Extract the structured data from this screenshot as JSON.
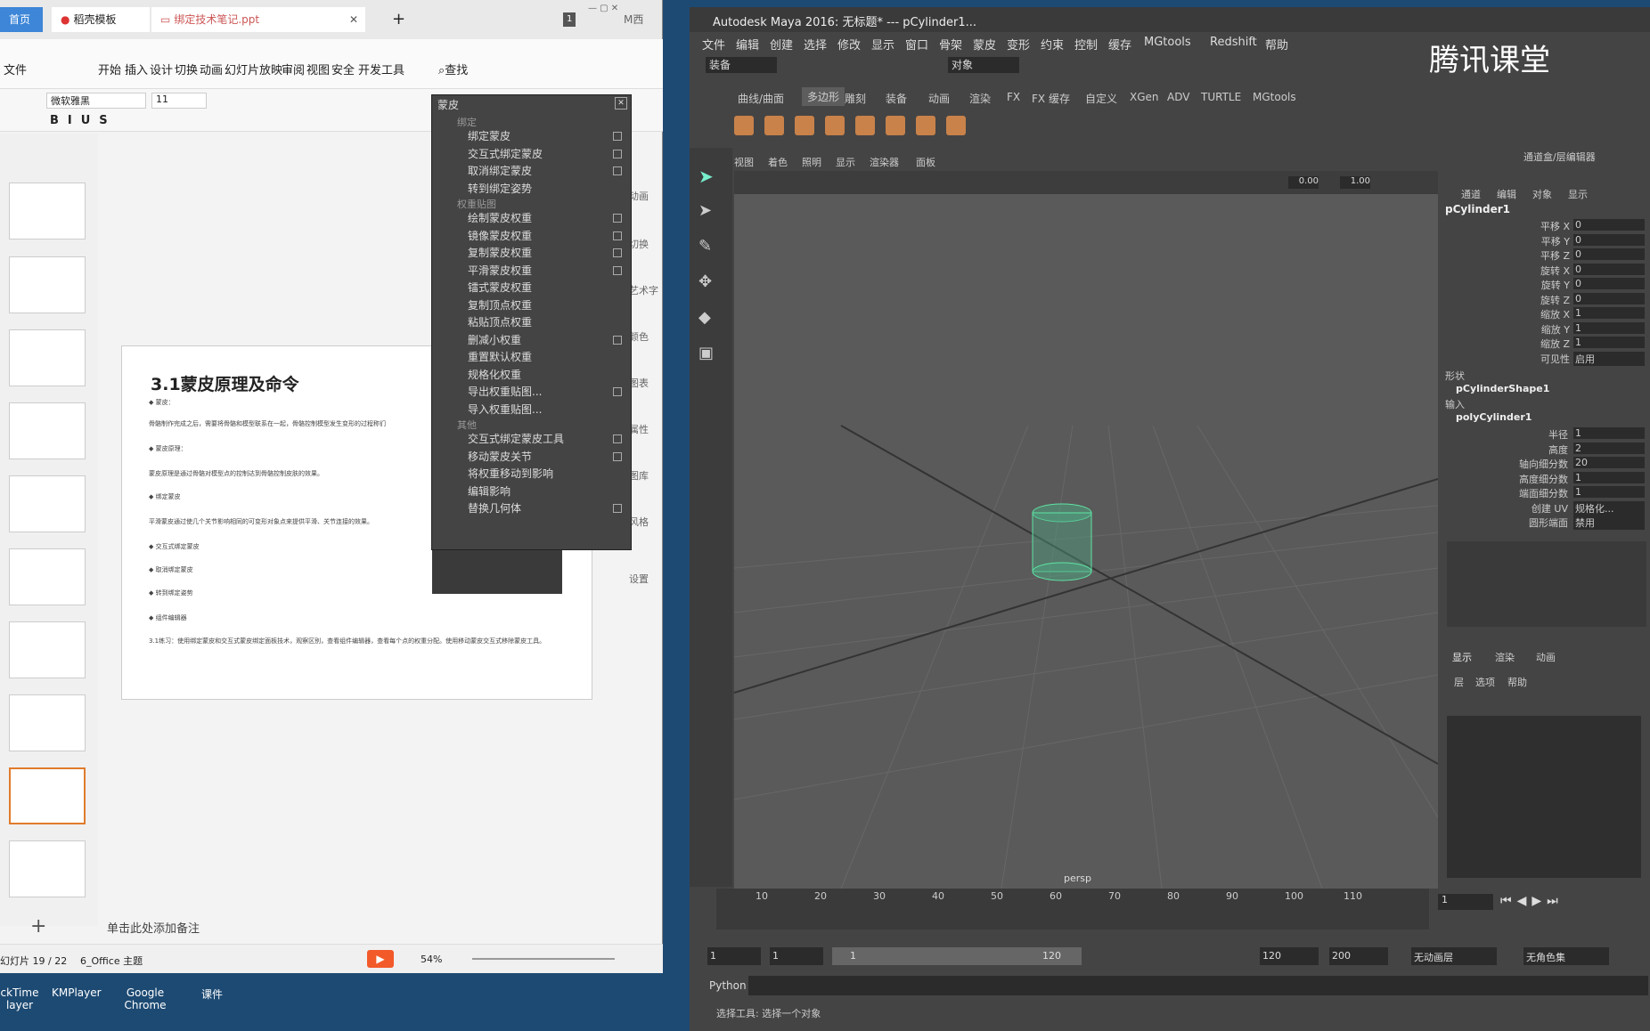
{
  "wps": {
    "tab_home": "首页",
    "tab_template": "稻壳模板",
    "tab_file": "绑定技术笔记.ppt",
    "tab_count": "1",
    "user": "M西",
    "menus": [
      "文件",
      "开始",
      "插入",
      "设计",
      "切换",
      "动画",
      "幻灯片放映",
      "审阅",
      "视图",
      "安全",
      "开发工具"
    ],
    "search": "查找",
    "font": "微软雅黑",
    "size": "11",
    "slide_title": "3.1蒙皮原理及命令",
    "slide_lines": [
      "◆ 蒙皮：",
      "骨骼制作完成之后，需要将骨骼和模型联系在一起，骨骼控制模型发生变形的过程称们",
      "◆ 蒙皮原理：",
      "蒙皮原理是通过骨骼对模型点的控制达到骨骼控制皮肤的效果。",
      "◆ 绑定蒙皮",
      "平滑蒙皮通过使几个关节影响相同的可变形对象点来提供平滑、关节连接的效果。",
      "◆ 交互式绑定蒙皮",
      "◆ 取消绑定蒙皮",
      "◆ 转到绑定姿势",
      "◆ 组件编辑器",
      "3.1练习：使用绑定蒙皮和交互式蒙皮绑定面板技术，观察区别，查看组件编辑器，查看每个点的权重分配。使用移动蒙皮交互式移除蒙皮工具。"
    ],
    "right_tools": [
      "动画",
      "切换",
      "艺术字",
      "颜色",
      "图表",
      "属性",
      "图库",
      "风格",
      "设置"
    ],
    "notes": "单击此处添加备注",
    "status_slide": "幻灯片 19 / 22",
    "theme": "6_Office 主题",
    "zoom": "54%",
    "taskbar": [
      "ckTime layer",
      "KMPlayer",
      "Google Chrome",
      "课件"
    ]
  },
  "menu": {
    "title": "蒙皮",
    "sections": [
      {
        "header": "绑定",
        "items": [
          {
            "label": "绑定蒙皮",
            "box": true
          },
          {
            "label": "交互式绑定蒙皮",
            "box": true
          },
          {
            "label": "取消绑定蒙皮",
            "box": true
          },
          {
            "label": "转到绑定姿势",
            "box": false
          }
        ]
      },
      {
        "header": "权重贴图",
        "items": [
          {
            "label": "绘制蒙皮权重",
            "box": true
          },
          {
            "label": "镜像蒙皮权重",
            "box": true
          },
          {
            "label": "复制蒙皮权重",
            "box": true
          },
          {
            "label": "平滑蒙皮权重",
            "box": true
          },
          {
            "label": "镭式蒙皮权重",
            "box": false
          },
          {
            "label": "复制顶点权重",
            "box": false
          },
          {
            "label": "粘贴顶点权重",
            "box": false
          },
          {
            "label": "删减小权重",
            "box": true
          },
          {
            "label": "重置默认权重",
            "box": false
          },
          {
            "label": "规格化权重",
            "box": false
          },
          {
            "label": "导出权重贴图...",
            "box": true
          },
          {
            "label": "导入权重贴图...",
            "box": false
          }
        ]
      },
      {
        "header": "其他",
        "items": [
          {
            "label": "交互式绑定蒙皮工具",
            "box": true
          },
          {
            "label": "移动蒙皮关节",
            "box": true
          },
          {
            "label": "将权重移动到影响",
            "box": false
          },
          {
            "label": "编辑影响",
            "box": false
          },
          {
            "label": "替换几何体",
            "box": true
          }
        ]
      }
    ]
  },
  "maya": {
    "title": "Autodesk Maya 2016: 无标题*   ---   pCylinder1...",
    "menus": [
      "文件",
      "编辑",
      "创建",
      "选择",
      "修改",
      "显示",
      "窗口",
      "骨架",
      "蒙皮",
      "变形",
      "约束",
      "控制",
      "缓存",
      "MGtools",
      "Redshift",
      "帮助"
    ],
    "mode": "装备",
    "object": "对象",
    "brand": "腾讯课堂",
    "shelf_tabs": [
      "曲线/曲面",
      "多边形",
      "雕刻",
      "装备",
      "动画",
      "渲染",
      "FX",
      "FX 缓存",
      "自定义",
      "XGen",
      "ADV",
      "TURTLE",
      "MGtools"
    ],
    "panel_menus": [
      "视图",
      "着色",
      "照明",
      "显示",
      "渲染器",
      "面板"
    ],
    "exp": "0.00",
    "gamma": "1.00",
    "camera": "persp",
    "cb_title": "通道盒/层编辑器",
    "cb_menus": [
      "通道",
      "编辑",
      "对象",
      "显示"
    ],
    "obj": "pCylinder1",
    "attrs": [
      {
        "n": "平移 X",
        "v": "0"
      },
      {
        "n": "平移 Y",
        "v": "0"
      },
      {
        "n": "平移 Z",
        "v": "0"
      },
      {
        "n": "旋转 X",
        "v": "0"
      },
      {
        "n": "旋转 Y",
        "v": "0"
      },
      {
        "n": "旋转 Z",
        "v": "0"
      },
      {
        "n": "缩放 X",
        "v": "1"
      },
      {
        "n": "缩放 Y",
        "v": "1"
      },
      {
        "n": "缩放 Z",
        "v": "1"
      },
      {
        "n": "可见性",
        "v": "启用"
      }
    ],
    "shape_h": "形状",
    "shape": "pCylinderShape1",
    "input_h": "输入",
    "input": "polyCylinder1",
    "inattrs": [
      {
        "n": "半径",
        "v": "1"
      },
      {
        "n": "高度",
        "v": "2"
      },
      {
        "n": "轴向细分数",
        "v": "20"
      },
      {
        "n": "高度细分数",
        "v": "1"
      },
      {
        "n": "端面细分数",
        "v": "1"
      },
      {
        "n": "创建 UV",
        "v": "规格化..."
      },
      {
        "n": "圆形端面",
        "v": "禁用"
      }
    ],
    "layer_tabs": [
      "显示",
      "渲染",
      "动画"
    ],
    "layer_menus": [
      "层",
      "选项",
      "帮助"
    ],
    "ticks": [
      "10",
      "20",
      "30",
      "40",
      "50",
      "60",
      "70",
      "80",
      "90",
      "100",
      "110"
    ],
    "cur_frame": "1",
    "range": [
      "1",
      "1",
      "1",
      "120",
      "120",
      "200"
    ],
    "anim_layer": "无动画层",
    "char": "无角色集",
    "python": "Python",
    "help": "选择工具: 选择一个对象"
  }
}
